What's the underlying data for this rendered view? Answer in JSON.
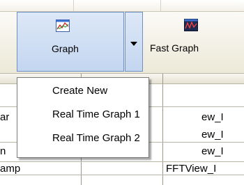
{
  "toolbar": {
    "graph_label": "Graph",
    "fast_graph_label": "Fast Graph"
  },
  "dropdown": {
    "items": [
      "Create New",
      "Real Time Graph 1",
      "Real Time Graph 2"
    ]
  },
  "grid": {
    "col1": [
      "ar",
      "",
      "n",
      "amp"
    ],
    "col3": [
      "ew_I",
      "ew_I",
      "ew_I",
      "FFTView_I"
    ]
  },
  "icons": {
    "graph": "graph-icon",
    "fast_graph": "fast-graph-icon"
  }
}
